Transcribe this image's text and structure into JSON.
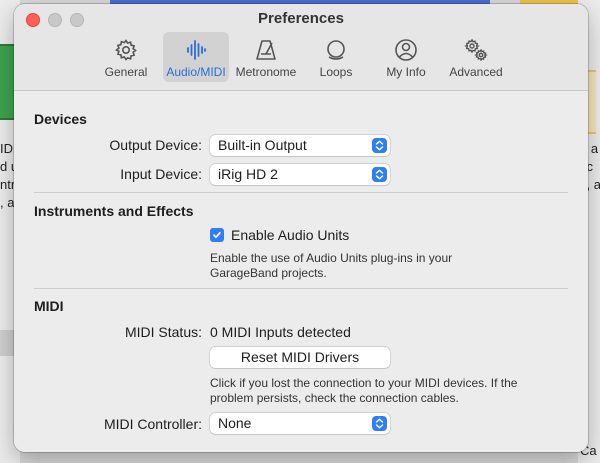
{
  "background": {
    "left_text": [
      "IDI",
      "d u",
      "ntr",
      ", a"
    ],
    "right_text": [
      "d a",
      "tic",
      "s, a"
    ],
    "right_bottom_text": "Ca"
  },
  "window": {
    "title": "Preferences",
    "tabs": [
      {
        "label": "General",
        "icon": "gear-icon"
      },
      {
        "label": "Audio/MIDI",
        "icon": "waveform-icon",
        "active": true
      },
      {
        "label": "Metronome",
        "icon": "metronome-icon"
      },
      {
        "label": "Loops",
        "icon": "loops-icon"
      },
      {
        "label": "My Info",
        "icon": "person-icon"
      },
      {
        "label": "Advanced",
        "icon": "gears-icon"
      }
    ]
  },
  "devices": {
    "heading": "Devices",
    "output_label": "Output Device:",
    "output_value": "Built-in Output",
    "input_label": "Input Device:",
    "input_value": "iRig HD 2"
  },
  "instruments": {
    "heading": "Instruments and Effects",
    "enable_label": "Enable Audio Units",
    "enable_checked": true,
    "help_line1": "Enable the use of Audio Units plug-ins in your",
    "help_line2": "GarageBand projects."
  },
  "midi": {
    "heading": "MIDI",
    "status_label": "MIDI Status:",
    "status_value": "0 MIDI Inputs detected",
    "reset_button": "Reset MIDI Drivers",
    "help_line1": "Click if you lost the connection to your MIDI devices. If the",
    "help_line2": "problem persists, check the connection cables.",
    "controller_label": "MIDI Controller:",
    "controller_value": "None"
  },
  "colors": {
    "accent": "#2f7ef6",
    "close": "#ff5f57"
  }
}
